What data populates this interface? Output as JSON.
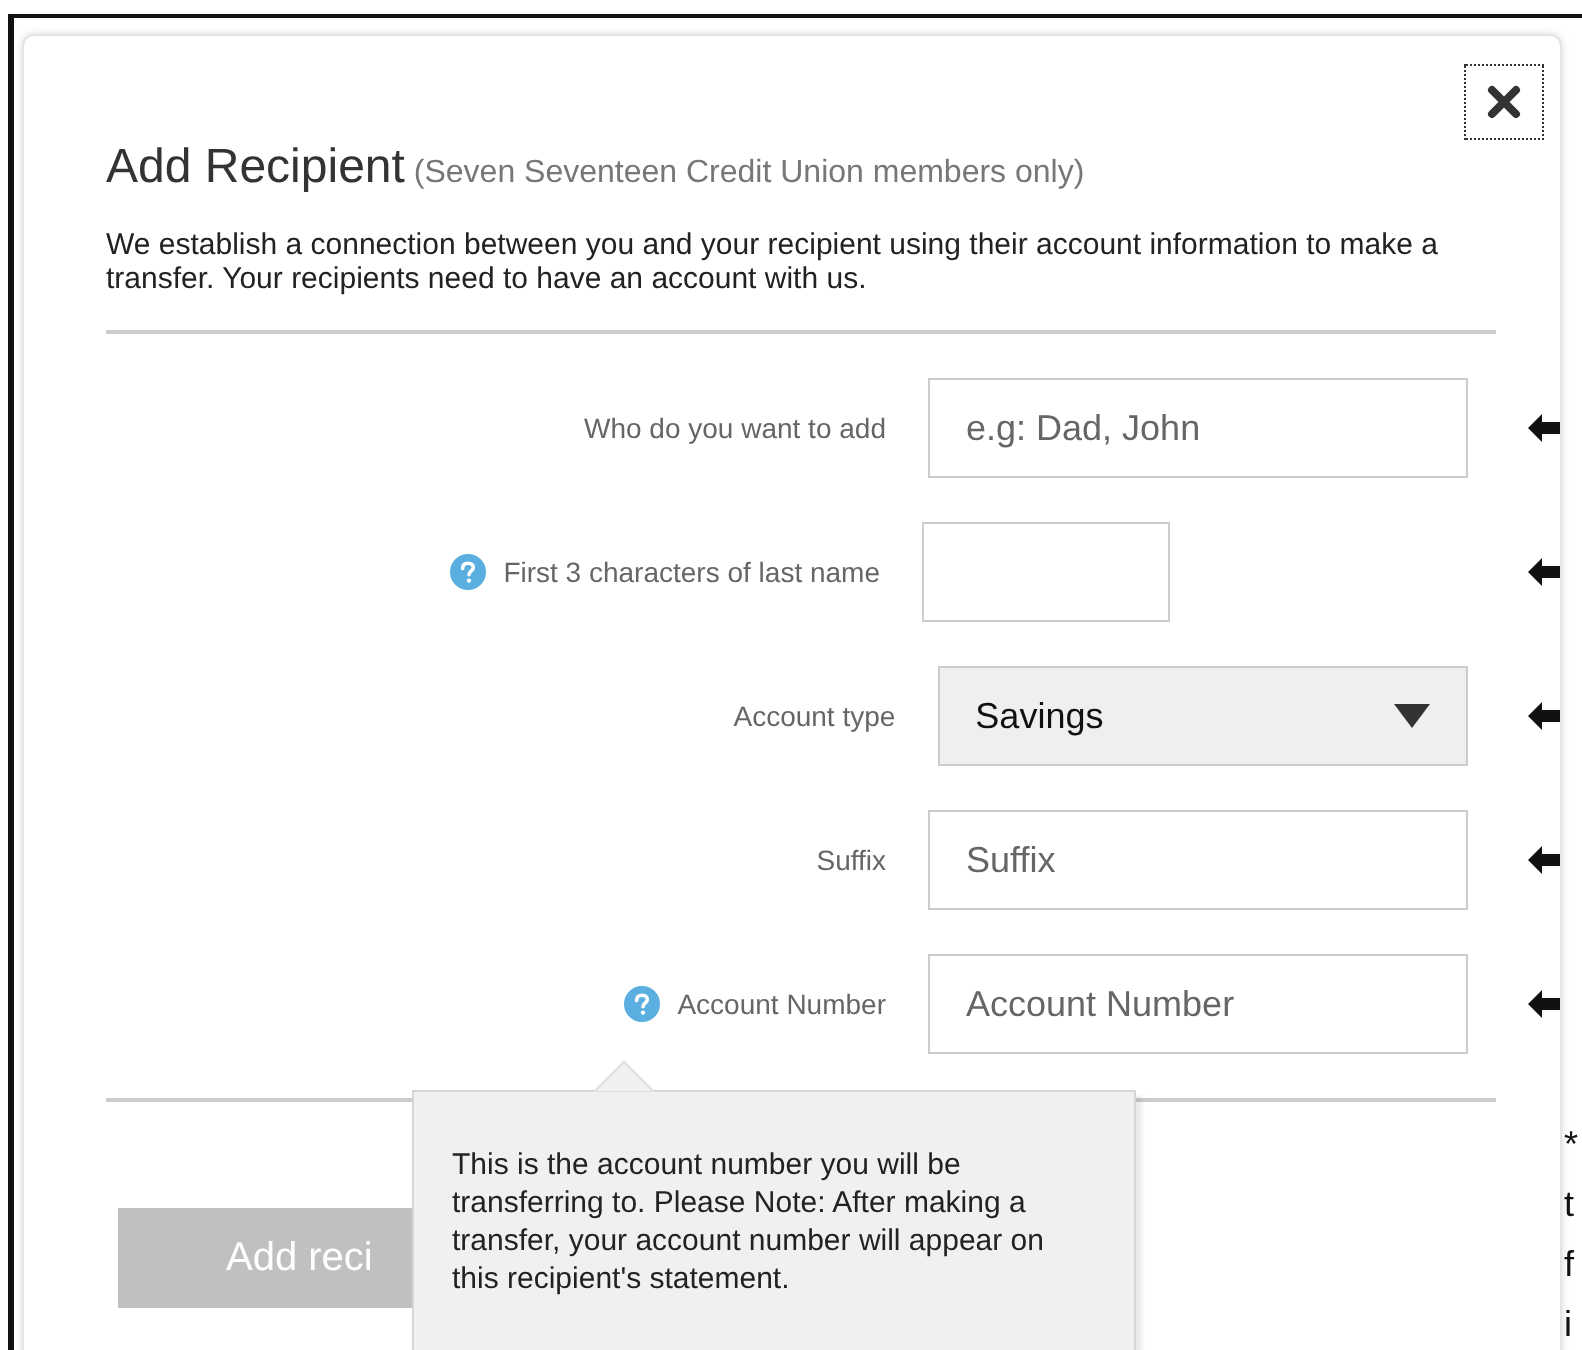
{
  "dialog": {
    "title": "Add Recipient",
    "subtitle": "(Seven Seventeen Credit Union members only)",
    "description": "We establish a connection between you and your recipient using their account information to make a transfer. Your recipients need to have an account with us."
  },
  "fields": [
    {
      "kind": "text",
      "label": "Who do you want to add",
      "placeholder": "e.g: Dad, John",
      "help": false
    },
    {
      "kind": "short_text",
      "label": "First 3 characters of last name",
      "help": true
    },
    {
      "kind": "select",
      "label": "Account type",
      "value": "Savings",
      "help": false
    },
    {
      "kind": "text",
      "label": "Suffix",
      "placeholder": "Suffix",
      "help": false
    },
    {
      "kind": "text",
      "label": "Account Number",
      "placeholder": "Account Number",
      "help": true
    }
  ],
  "tooltip": {
    "text": "This is the account number you will be transferring to. Please Note: After making a transfer, your account number will appear on this recipient's statement."
  },
  "submit_button": {
    "label": "Add reci",
    "disabled": true
  },
  "side_note_lines": [
    "*",
    "t",
    "f",
    "i"
  ]
}
